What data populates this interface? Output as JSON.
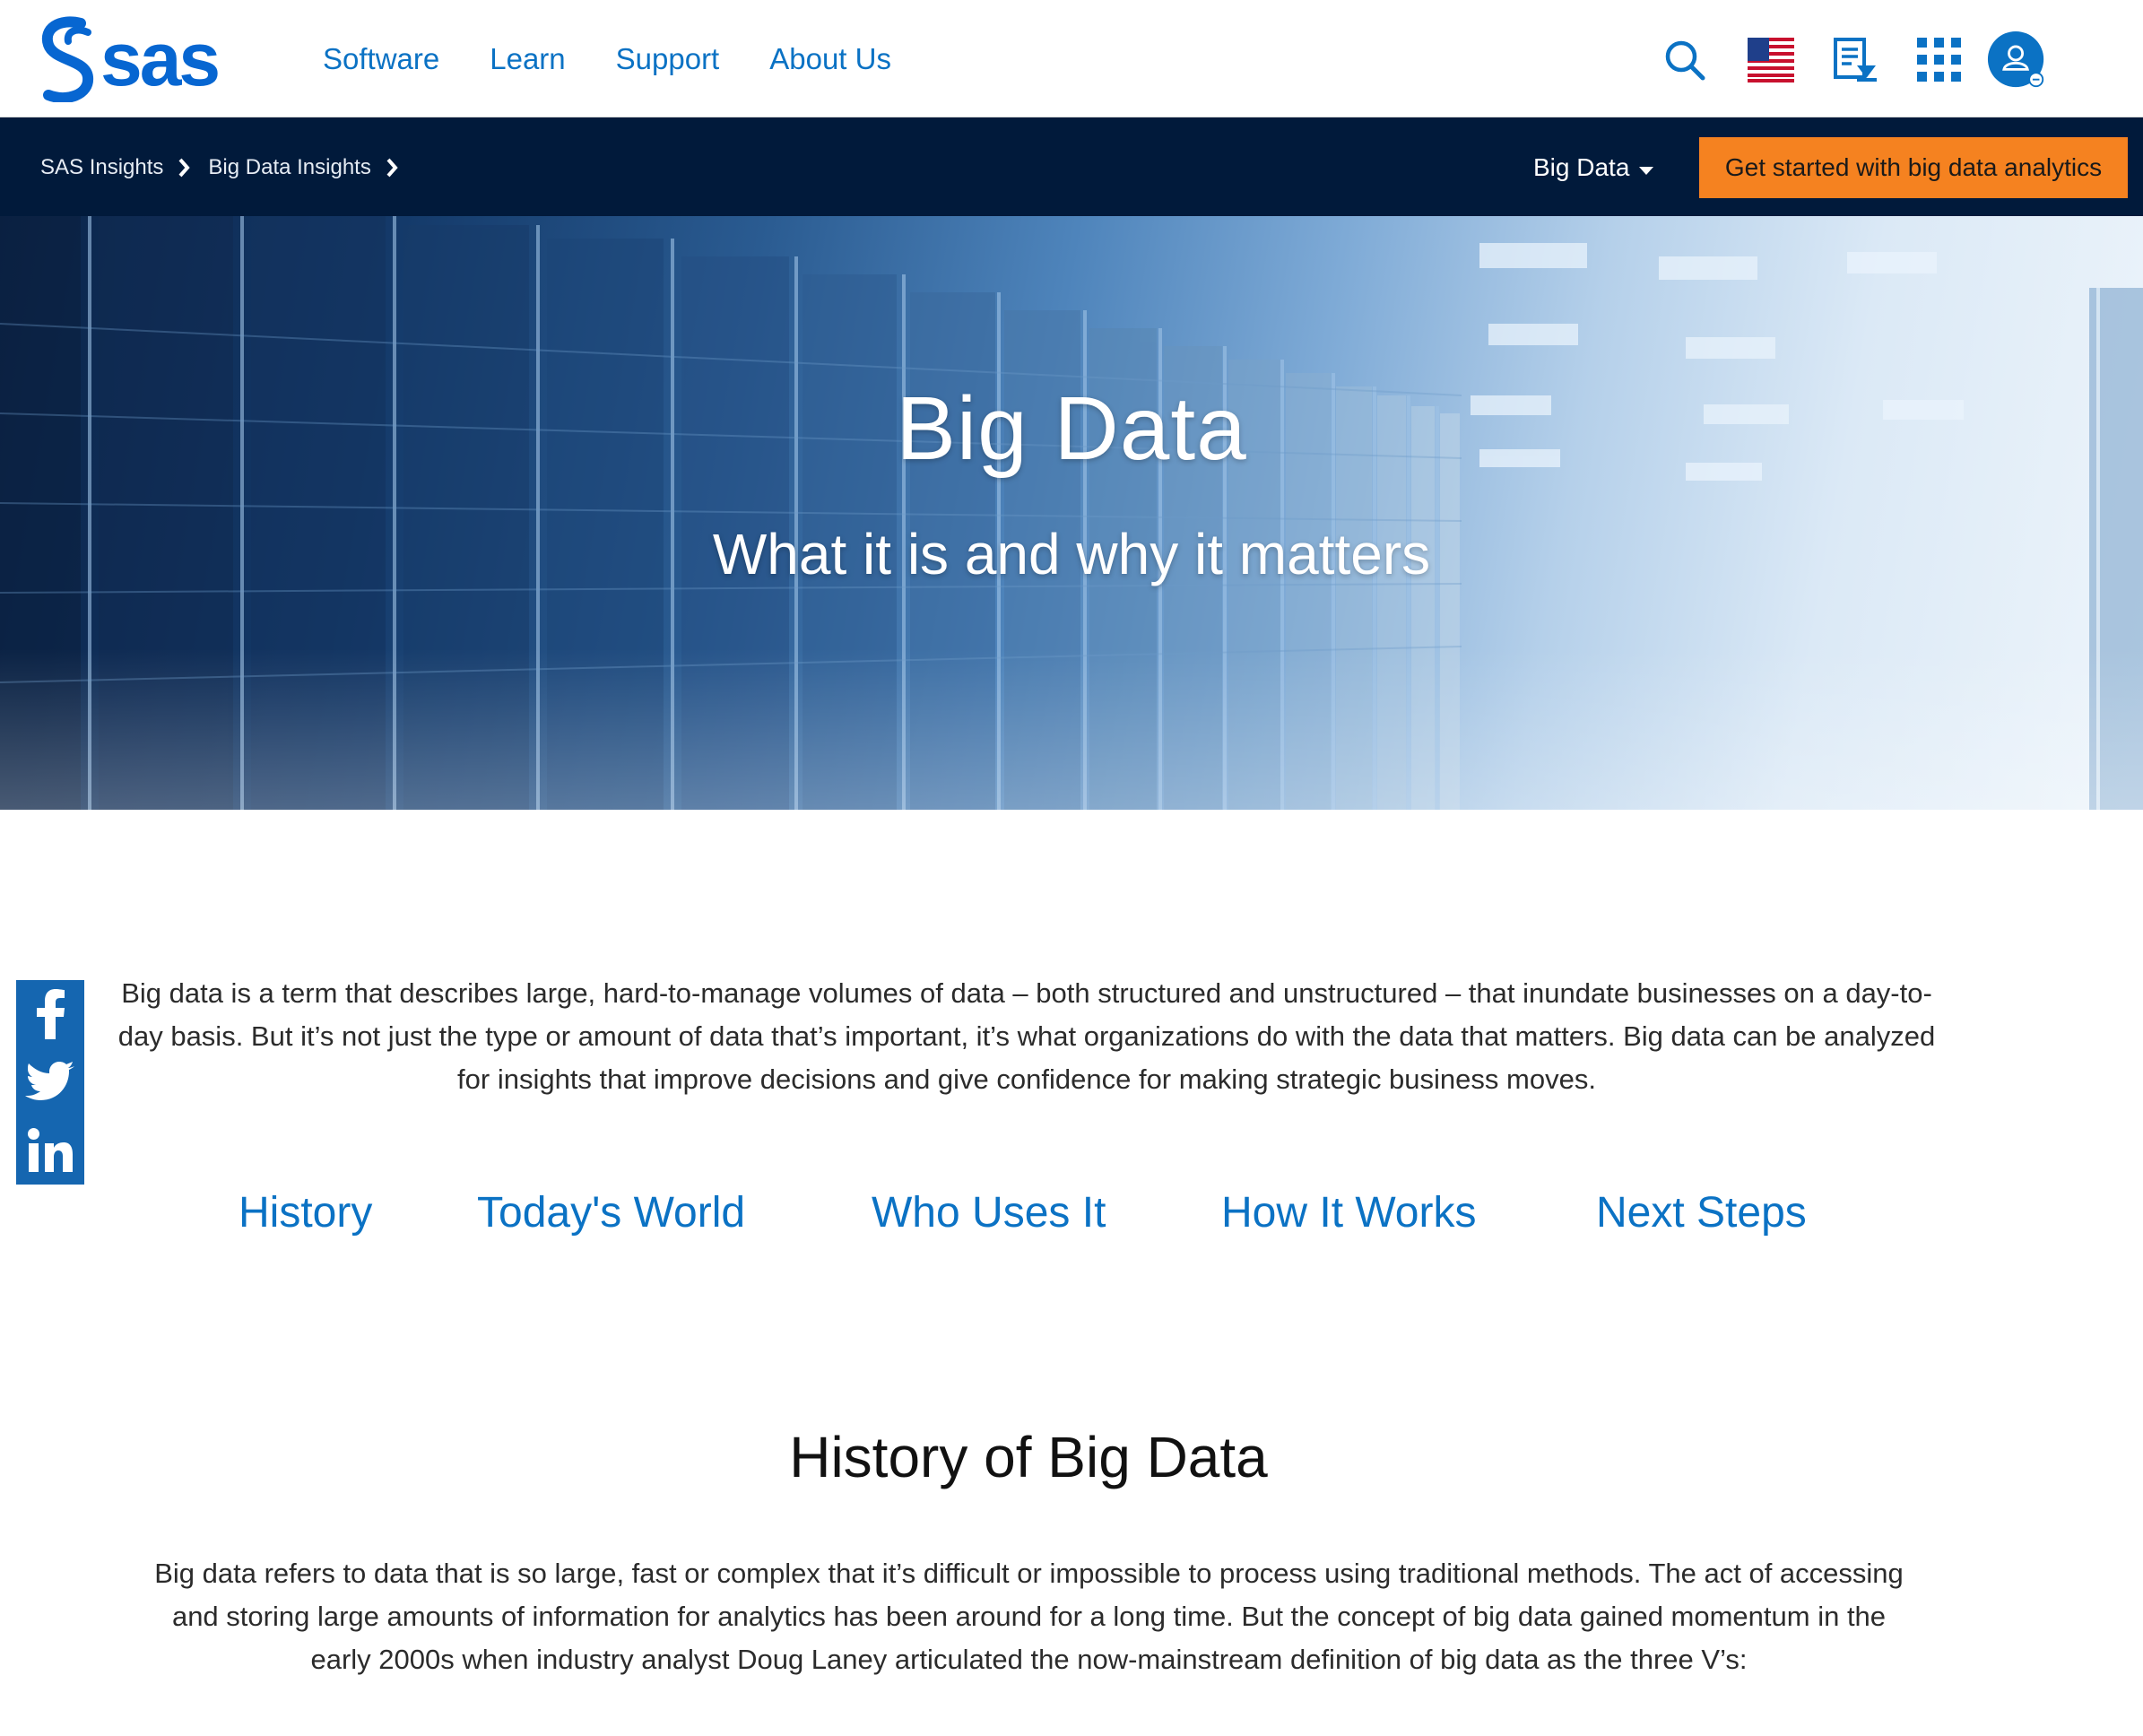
{
  "header": {
    "logo_text": "sas",
    "nav": [
      "Software",
      "Learn",
      "Support",
      "About Us"
    ],
    "icons": [
      "search-icon",
      "us-flag-icon",
      "document-download-icon",
      "apps-grid-icon",
      "user-account-icon"
    ],
    "colors": {
      "link": "#0b72c4",
      "logo": "#0766d1"
    }
  },
  "subbar": {
    "breadcrumbs": [
      "SAS Insights",
      "Big Data Insights"
    ],
    "topic_selector": "Big Data",
    "cta": "Get started with big data analytics",
    "colors": {
      "background": "#011a3b",
      "cta": "#f58220"
    }
  },
  "hero": {
    "title": "Big Data",
    "subtitle": "What it is and why it matters"
  },
  "share": [
    "facebook-icon",
    "twitter-icon",
    "linkedin-icon"
  ],
  "intro": "Big data is a term that describes large, hard-to-manage volumes of data – both structured and unstructured – that inundate businesses on a day-to-day basis. But it’s not just the type or amount of data that’s important, it’s what organizations do with the data that matters. Big data can be analyzed for insights that improve decisions and give confidence for making strategic business moves.",
  "section_nav": [
    "History",
    "Today's World",
    "Who Uses It",
    "How It Works",
    "Next Steps"
  ],
  "history": {
    "heading": "History of Big Data",
    "paragraph": "Big data refers to data that is so large, fast or complex that it’s difficult or impossible to process using traditional methods. The act of accessing and storing large amounts of information for analytics has been around for a long time. But the concept of big data gained momentum in the early 2000s when industry analyst Doug Laney articulated the now-mainstream definition of big data as the three V’s:"
  }
}
